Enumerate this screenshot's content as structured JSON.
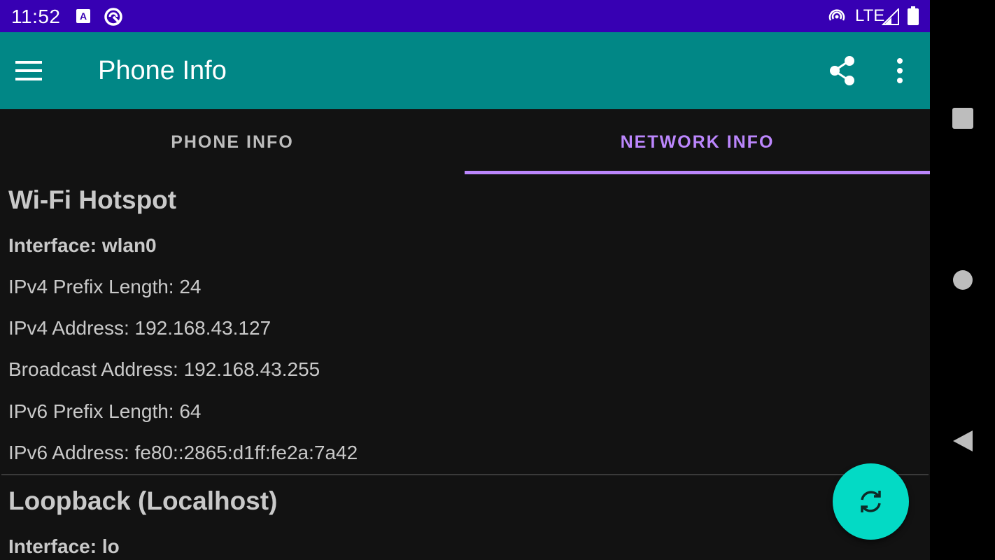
{
  "status_bar": {
    "time": "11:52",
    "network_type": "LTE",
    "icons": [
      "accessibility-a-icon",
      "sync-circle-icon",
      "hotspot-icon",
      "signal-icon",
      "battery-icon"
    ]
  },
  "app_bar": {
    "title": "Phone Info",
    "color": "#018786",
    "icons": [
      "menu-icon",
      "share-icon",
      "more-vert-icon"
    ]
  },
  "tabs": [
    {
      "label": "PHONE INFO",
      "selected": false
    },
    {
      "label": "NETWORK INFO",
      "selected": true
    }
  ],
  "accent_color": "#bb86fc",
  "sections": [
    {
      "title": "Wi-Fi Hotspot",
      "rows": [
        "Interface: wlan0",
        "IPv4 Prefix Length: 24",
        "IPv4 Address: 192.168.43.127",
        "Broadcast Address: 192.168.43.255",
        "IPv6 Prefix Length: 64",
        "IPv6 Address: fe80::2865:d1ff:fe2a:7a42"
      ]
    },
    {
      "title": "Loopback (Localhost)",
      "rows": [
        "Interface: lo"
      ]
    }
  ],
  "fab": {
    "icon": "refresh-icon",
    "color": "#03dac5"
  },
  "nav_bar": {
    "icons": [
      "recents-square-icon",
      "home-circle-icon",
      "back-triangle-icon"
    ]
  }
}
